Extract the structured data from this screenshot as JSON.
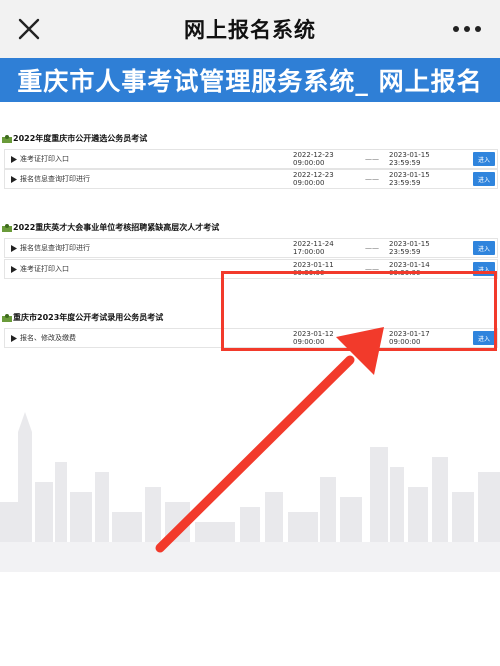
{
  "topbar": {
    "title": "网上报名系统",
    "close_icon": "close-icon",
    "more_icon": "more-dots-icon"
  },
  "banner": {
    "text": "重庆市人事考试管理服务系统_ 网上报名"
  },
  "colors": {
    "banner_bg": "#2f7fd6",
    "enter_button": "#2f84dd",
    "highlight": "#f23a2b"
  },
  "sections": [
    {
      "title": "2022年度重庆市公开遴选公务员考试",
      "rows": [
        {
          "name": "准考证打印入口",
          "start": "2022-12-23 09:00:00",
          "sep": "——",
          "end": "2023-01-15 23:59:59",
          "button": "进入"
        },
        {
          "name": "报名信息查询打印进行",
          "start": "2022-12-23 09:00:00",
          "sep": "——",
          "end": "2023-01-15 23:59:59",
          "button": "进入"
        }
      ]
    },
    {
      "title": "2022重庆英才大会事业单位考核招聘紧缺高层次人才考试",
      "rows": [
        {
          "name": "报名信息查询打印进行",
          "start": "2022-11-24 17:00:00",
          "sep": "——",
          "end": "2023-01-15 23:59:59",
          "button": "进入"
        },
        {
          "name": "准考证打印入口",
          "start": "2023-01-11 09:30:00",
          "sep": "——",
          "end": "2023-01-14 09:30:00",
          "button": "进入"
        }
      ]
    },
    {
      "title": "重庆市2023年度公开考试录用公务员考试",
      "rows": [
        {
          "name": "报名、修改及缴费",
          "start": "2023-01-12 09:00:00",
          "sep": "——",
          "end": "2023-01-17 09:00:00",
          "button": "进入"
        }
      ]
    }
  ]
}
